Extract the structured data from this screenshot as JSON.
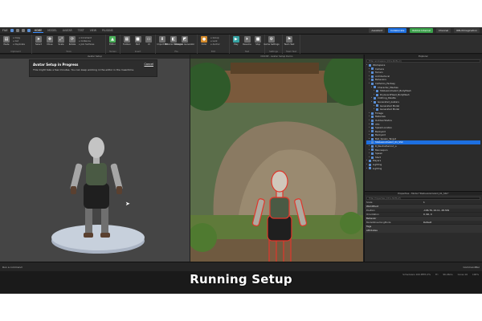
{
  "menubar": {
    "file": "FILE",
    "tabs": [
      "HOME",
      "MODEL",
      "AVATAR",
      "TEST",
      "VIEW",
      "PLUGINS"
    ],
    "active_tab": "HOME",
    "right": {
      "assistant": "Assistant",
      "collaborate": "Collaborate",
      "internal": "Roblox Internal",
      "channel": "Channel",
      "user": "RBLXImagination"
    }
  },
  "ribbon": {
    "clipboard": {
      "label": "Clipboard",
      "items": [
        "Copy",
        "Cut",
        "Duplicate"
      ],
      "paste": "Paste"
    },
    "tools": {
      "label": "Tools",
      "buttons": [
        "Select",
        "Move",
        "Scale",
        "Rotate"
      ],
      "options": [
        "Increment",
        "Collisions",
        "Join Surfaces"
      ]
    },
    "terrain": {
      "label": "Terrain",
      "buttons": [
        "Editor"
      ]
    },
    "insert": {
      "label": "Insert",
      "buttons": [
        "Toolbox",
        "Part",
        "UI"
      ]
    },
    "file": {
      "label": "File",
      "buttons": [
        "Import 3D",
        "Material Manager",
        "Material Generator"
      ]
    },
    "edit": {
      "label": "Edit",
      "buttons": [
        "Color"
      ],
      "options": [
        "Group",
        "Lock",
        "Anchor"
      ]
    },
    "test": {
      "label": "Test",
      "buttons": [
        "Play",
        "Resume",
        "Stop"
      ]
    },
    "settings": {
      "label": "Settings",
      "buttons": [
        "Game Settings"
      ]
    },
    "team_test": {
      "label": "Team Test",
      "buttons": [
        "Team Test"
      ]
    }
  },
  "left_pane": {
    "title": "Avatar Setup",
    "notice": {
      "title": "Avatar Setup in Progress",
      "body": "This might take a few minutes. You can keep working in the editor in the meantime.",
      "cancel": "Cancel"
    }
  },
  "mid_pane": {
    "title": "DOCSE - Avatar Setup Demo"
  },
  "explorer": {
    "title": "Explorer",
    "filter_placeholder": "Filter workspace (Ctrl+Shift+X)",
    "rows": [
      {
        "label": "Workspace",
        "depth": 0,
        "icon": "workspace-icon"
      },
      {
        "label": "Camera",
        "depth": 1,
        "icon": "camera-icon"
      },
      {
        "label": "Terrain",
        "depth": 1,
        "icon": "terrain-icon"
      },
      {
        "label": "Architectural",
        "depth": 1,
        "icon": "folder-icon"
      },
      {
        "label": "Behaviors",
        "depth": 1,
        "icon": "folder-icon"
      },
      {
        "label": "Catholics_Fantasy",
        "depth": 1,
        "icon": "folder-icon"
      },
      {
        "label": "Character_Meshes",
        "depth": 2,
        "icon": "folder-icon"
      },
      {
        "label": "StatueAnimeGirl_BodyMesh",
        "depth": 3,
        "icon": "mesh-icon"
      },
      {
        "label": "DryGuardHead_BodyMesh",
        "depth": 3,
        "icon": "mesh-icon"
      },
      {
        "label": "Clothing_Palette",
        "depth": 2,
        "icon": "folder-icon"
      },
      {
        "label": "Generated_Avatars",
        "depth": 2,
        "icon": "folder-icon"
      },
      {
        "label": "Generated Model",
        "depth": 3,
        "icon": "model-icon"
      },
      {
        "label": "Generated Model",
        "depth": 3,
        "icon": "model-icon"
      },
      {
        "label": "Foliage",
        "depth": 1,
        "icon": "folder-icon"
      },
      {
        "label": "Materials",
        "depth": 1,
        "icon": "folder-icon"
      },
      {
        "label": "OutdoorStatics",
        "depth": 1,
        "icon": "folder-icon"
      },
      {
        "label": "VFX",
        "depth": 1,
        "icon": "folder-icon"
      },
      {
        "label": "SpawnLocation",
        "depth": 1,
        "icon": "spawn-icon"
      },
      {
        "label": "Backyard",
        "depth": 1,
        "icon": "model-icon"
      },
      {
        "label": "Backyard",
        "depth": 1,
        "icon": "model-icon"
      },
      {
        "label": "Ball_Spawn_Target",
        "depth": 1,
        "icon": "part-icon"
      },
      {
        "label": "StatueAnimeGirl_01_SSC",
        "depth": 1,
        "icon": "model-icon",
        "selected": true
      },
      {
        "label": "R_Neutralhaircut_a",
        "depth": 1,
        "icon": "model-icon"
      },
      {
        "label": "Mannequin",
        "depth": 1,
        "icon": "model-icon"
      },
      {
        "label": "Spawn",
        "depth": 1,
        "icon": "spawn-icon"
      },
      {
        "label": "Start",
        "depth": 1,
        "icon": "part-icon"
      },
      {
        "label": "Players",
        "depth": 0,
        "icon": "players-icon"
      },
      {
        "label": "Lighting",
        "depth": 0,
        "icon": "lighting-icon"
      },
      {
        "label": "Lighting",
        "depth": 0,
        "icon": "lighting-icon"
      }
    ]
  },
  "properties": {
    "title": "Properties - Model \"StatueAnimeGirl_01_SSC\"",
    "filter_placeholder": "Filter Properties (Ctrl+Shift+P)",
    "rows": [
      {
        "type": "row",
        "key": "Scale",
        "value": "1"
      },
      {
        "type": "section",
        "key": "WorldPivot"
      },
      {
        "type": "row",
        "key": "Position",
        "value": "-106.76, 24.11, 28.349"
      },
      {
        "type": "row",
        "key": "Orientation",
        "value": "0, 90, 0"
      },
      {
        "type": "section",
        "key": "Behavior"
      },
      {
        "type": "row",
        "key": "ModelStreamingMode",
        "value": "Default"
      },
      {
        "type": "section",
        "key": "Tags"
      },
      {
        "type": "section",
        "key": "Attributes"
      }
    ]
  },
  "command_bar": {
    "run_label": "Run a command",
    "right": "CommandBar"
  },
  "status": {
    "items": [
      "Schedulers 100.8FPS 2%",
      "Fri",
      "96.26ms",
      "Cores 16",
      "100%"
    ]
  },
  "caption": "Running Setup"
}
